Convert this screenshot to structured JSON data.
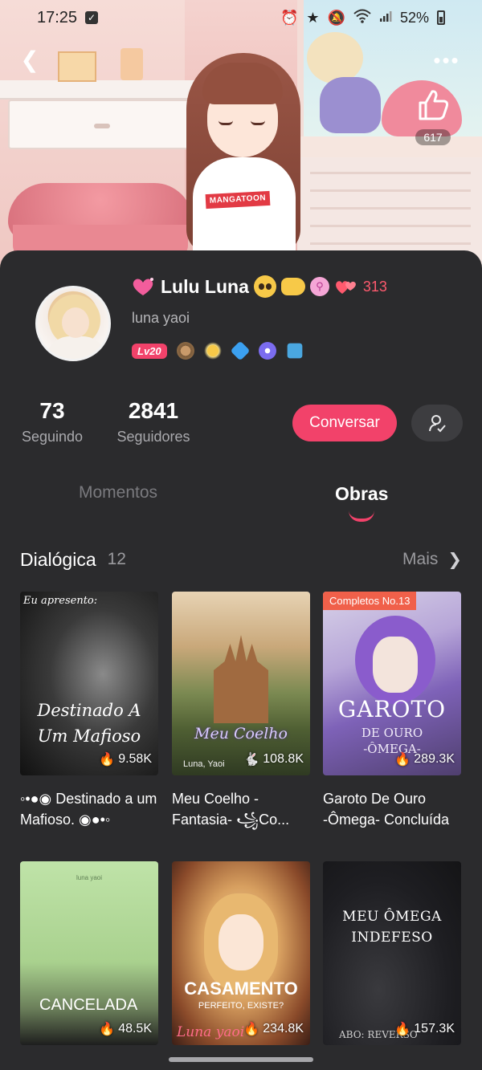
{
  "status_bar": {
    "time": "17:25",
    "battery": "52%"
  },
  "hero": {
    "like_count": "617",
    "shirt_text": "MANGATOON"
  },
  "profile": {
    "name": "Lulu Luna",
    "heart_count": "313",
    "handle": "luna yaoi",
    "level": "Lv20"
  },
  "stats": {
    "following_count": "73",
    "following_label": "Seguindo",
    "followers_count": "2841",
    "followers_label": "Seguidores"
  },
  "actions": {
    "chat_label": "Conversar"
  },
  "tabs": [
    {
      "label": "Momentos"
    },
    {
      "label": "Obras"
    }
  ],
  "section": {
    "title": "Dialógica",
    "count": "12",
    "more_label": "Mais"
  },
  "works": [
    {
      "title": "◦•●◉ Destinado a um Mafioso. ◉●•◦",
      "views": "9.58K",
      "cover_tag": "Eu apresento:",
      "cover_title": "Destinado A Um Mafioso"
    },
    {
      "title": "Meu Coelho -Fantasia- ꧁Co...",
      "views": "108.8K",
      "cover_title": "Meu Coelho",
      "cover_author": "Luna, Yaoi"
    },
    {
      "title": "Garoto De Ouro -Ômega- Concluída",
      "views": "289.3K",
      "cover_ribbon": "Completos No.13",
      "cover_title": "GAROTO",
      "cover_subtitle": "DE OURO -ÔMEGA-"
    },
    {
      "views": "48.5K",
      "cover_title": "CANCELADA",
      "cover_top": "luna yaoi"
    },
    {
      "views": "234.8K",
      "cover_title": "CASAMENTO",
      "cover_subtitle": "PERFEITO, EXISTE?",
      "cover_author": "Luna yaoi"
    },
    {
      "views": "157.3K",
      "cover_title": "MEU ÔMEGA INDEFESO",
      "cover_author": "ABO: REVERSO"
    }
  ],
  "colors": {
    "accent": "#f2426a",
    "background": "#2b2b2d",
    "ribbon": "#f0604a"
  },
  "icons": [
    "back-arrow-icon",
    "more-dots-icon",
    "thumbs-up-icon",
    "chevron-right-icon",
    "user-follow-icon",
    "fire-icon"
  ]
}
